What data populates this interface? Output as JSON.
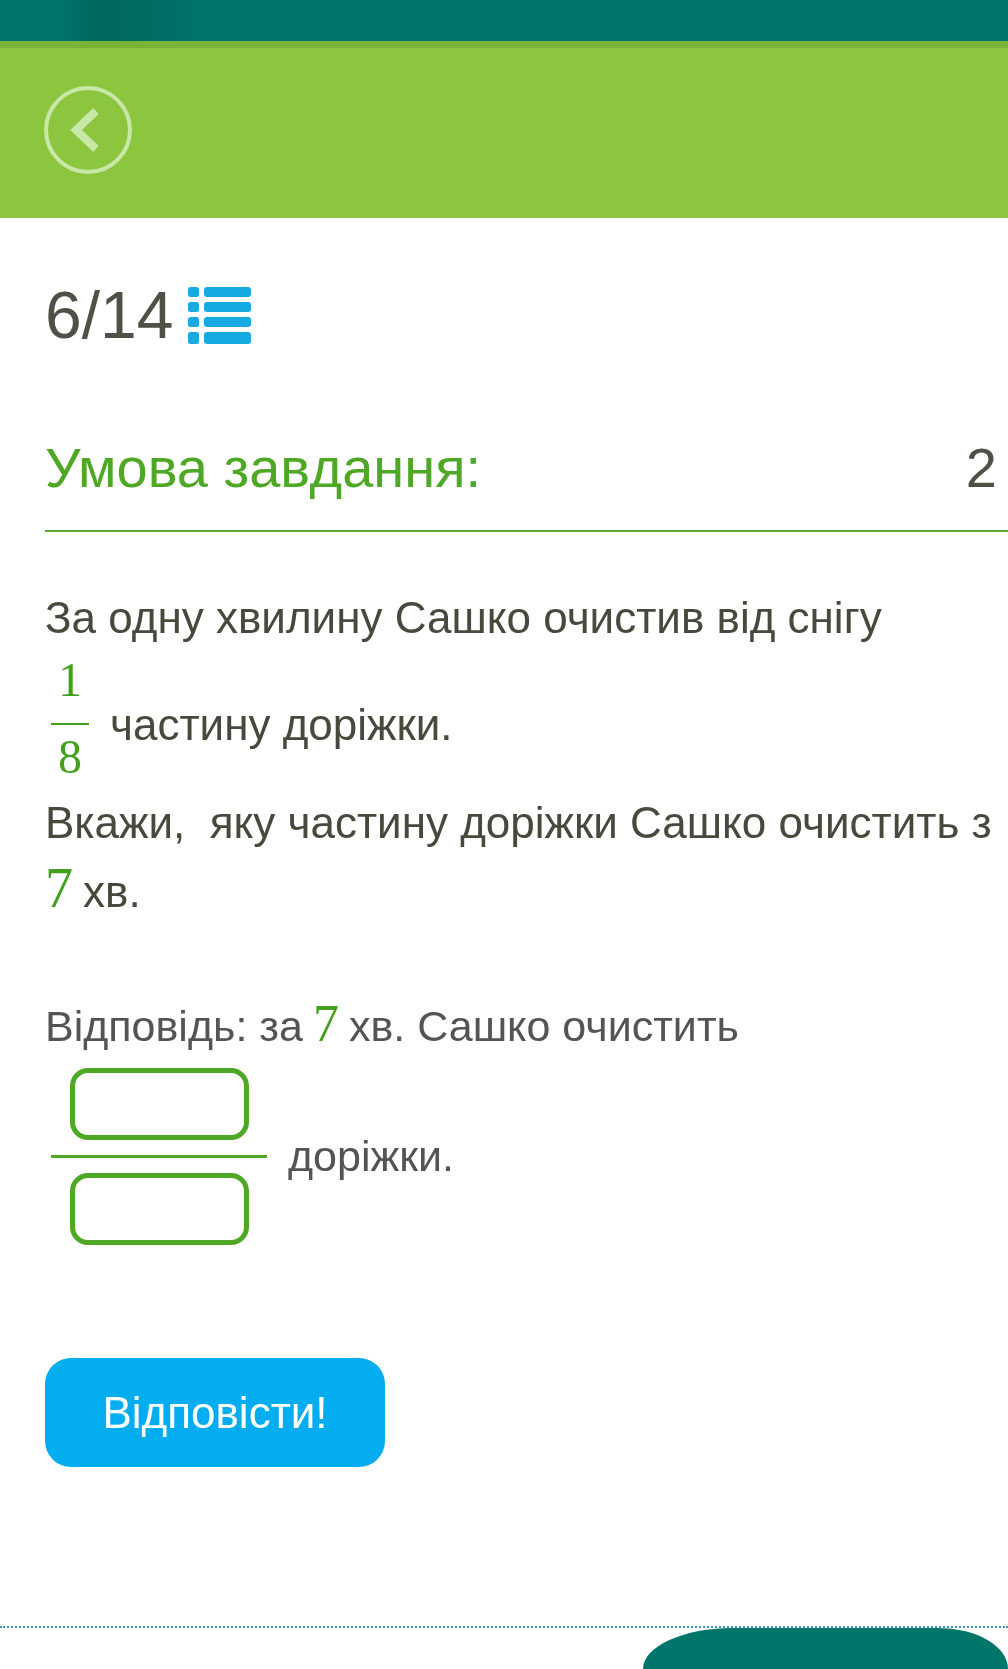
{
  "progress": {
    "counter": "6/14"
  },
  "task": {
    "heading": "Умова завдання:",
    "corner_text": "2"
  },
  "problem": [
    {
      "kind": "text",
      "text": "За одну хвилину Сашко очистив від снігу"
    },
    {
      "kind": "fraction",
      "numerator": "1",
      "denominator": "8",
      "text": "частину доріжки."
    },
    {
      "kind": "text",
      "text": "Вкажи,  яку частину доріжки Сашко очистить з"
    },
    {
      "kind": "number",
      "number": "7",
      "text": "хв."
    }
  ],
  "answer": {
    "prefix": "Відповідь: за",
    "number": "7",
    "suffix": "хв. Сашко очистить",
    "after_fraction": "доріжки."
  },
  "submit_button": {
    "label": "Відповісти!"
  }
}
